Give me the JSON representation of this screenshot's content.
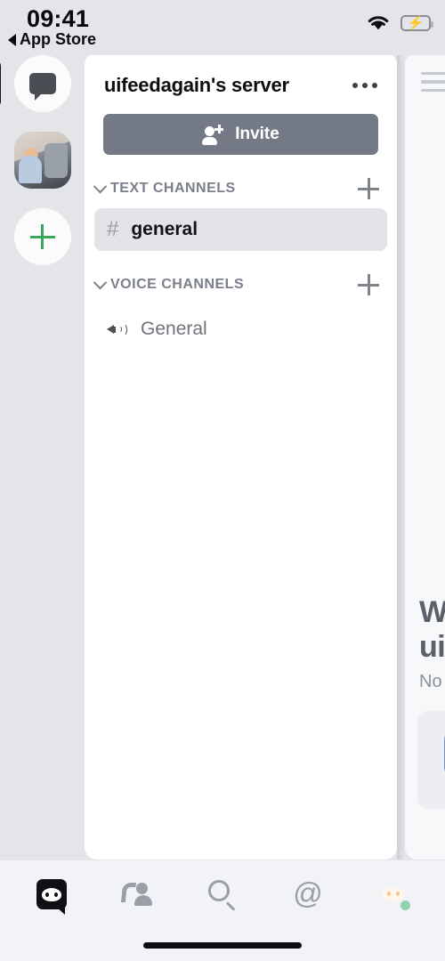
{
  "status_bar": {
    "time": "09:41",
    "back_label": "App Store",
    "wifi_icon": "wifi-icon",
    "battery_icon": "battery-charging-icon"
  },
  "server_rail": {
    "items": [
      {
        "name": "direct-messages",
        "icon": "chat-bubble-icon",
        "active": false
      },
      {
        "name": "uifeedagain-server",
        "icon": "server-avatar-photo",
        "active": true
      },
      {
        "name": "add-server",
        "icon": "plus-icon",
        "active": false
      }
    ]
  },
  "sidebar": {
    "server_name": "uifeedagain's server",
    "more_icon": "overflow-menu-icon",
    "invite_label": "Invite",
    "invite_icon": "person-add-icon",
    "sections": [
      {
        "label": "TEXT CHANNELS",
        "collapse_icon": "chevron-down-icon",
        "add_icon": "plus-icon",
        "channels": [
          {
            "name": "general",
            "icon": "hash-icon",
            "selected": true
          }
        ]
      },
      {
        "label": "VOICE CHANNELS",
        "collapse_icon": "chevron-down-icon",
        "add_icon": "plus-icon",
        "channels": [
          {
            "name": "General",
            "icon": "speaker-icon",
            "selected": false
          }
        ]
      }
    ]
  },
  "channel_panel_peek": {
    "menu_icon": "hamburger-menu-icon",
    "welcome_line1": "W",
    "welcome_line2": "ui",
    "welcome_sub": "No"
  },
  "tab_bar": {
    "tabs": [
      {
        "name": "servers",
        "icon": "discord-logo-icon",
        "active": true
      },
      {
        "name": "friends",
        "icon": "friends-wave-icon",
        "active": false
      },
      {
        "name": "search",
        "icon": "search-icon",
        "active": false
      },
      {
        "name": "mentions",
        "icon": "at-mention-icon",
        "label": "@",
        "active": false
      },
      {
        "name": "profile",
        "icon": "user-avatar-icon",
        "active": false
      }
    ]
  },
  "colors": {
    "background": "#e4e5e9",
    "panel": "#ffffff",
    "invite_button": "#737a86",
    "selected_channel": "#e2e3e6",
    "accent_green": "#3ba55d",
    "online_green": "#8fd2b0",
    "blurple": "#7f8ed4"
  }
}
